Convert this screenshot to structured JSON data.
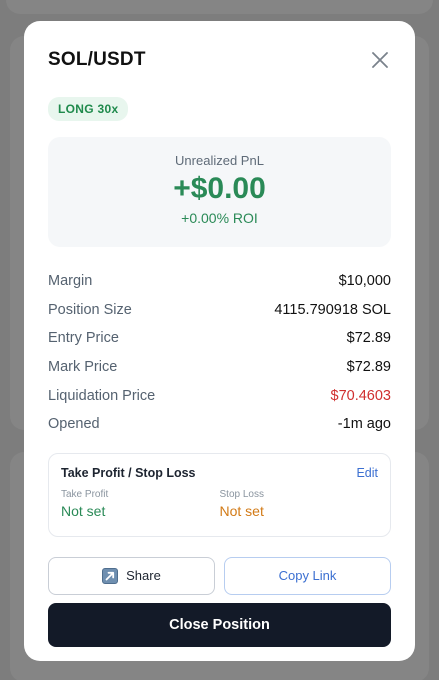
{
  "modal": {
    "title": "SOL/USDT",
    "close_icon": "close-icon",
    "badge": "LONG 30x"
  },
  "pnl": {
    "label": "Unrealized PnL",
    "value": "+$0.00",
    "roi": "+0.00% ROI"
  },
  "details": [
    {
      "label": "Margin",
      "value": "$10,000"
    },
    {
      "label": "Position Size",
      "value": "4115.790918 SOL"
    },
    {
      "label": "Entry Price",
      "value": "$72.89"
    },
    {
      "label": "Mark Price",
      "value": "$72.89"
    },
    {
      "label": "Liquidation Price",
      "value": "$70.4603"
    },
    {
      "label": "Opened",
      "value": "-1m ago"
    }
  ],
  "tpsl": {
    "title": "Take Profit / Stop Loss",
    "edit": "Edit",
    "take_profit_label": "Take Profit",
    "take_profit_value": "Not set",
    "stop_loss_label": "Stop Loss",
    "stop_loss_value": "Not set"
  },
  "actions": {
    "share": "Share",
    "share_icon": "share-arrow-icon",
    "copy_link": "Copy Link",
    "close_position": "Close Position"
  },
  "colors": {
    "positive": "#2a8a57",
    "liquidation": "#d02f2f",
    "stop_loss": "#d27a16",
    "link": "#3b6fd1",
    "primary_button": "#131a28"
  }
}
